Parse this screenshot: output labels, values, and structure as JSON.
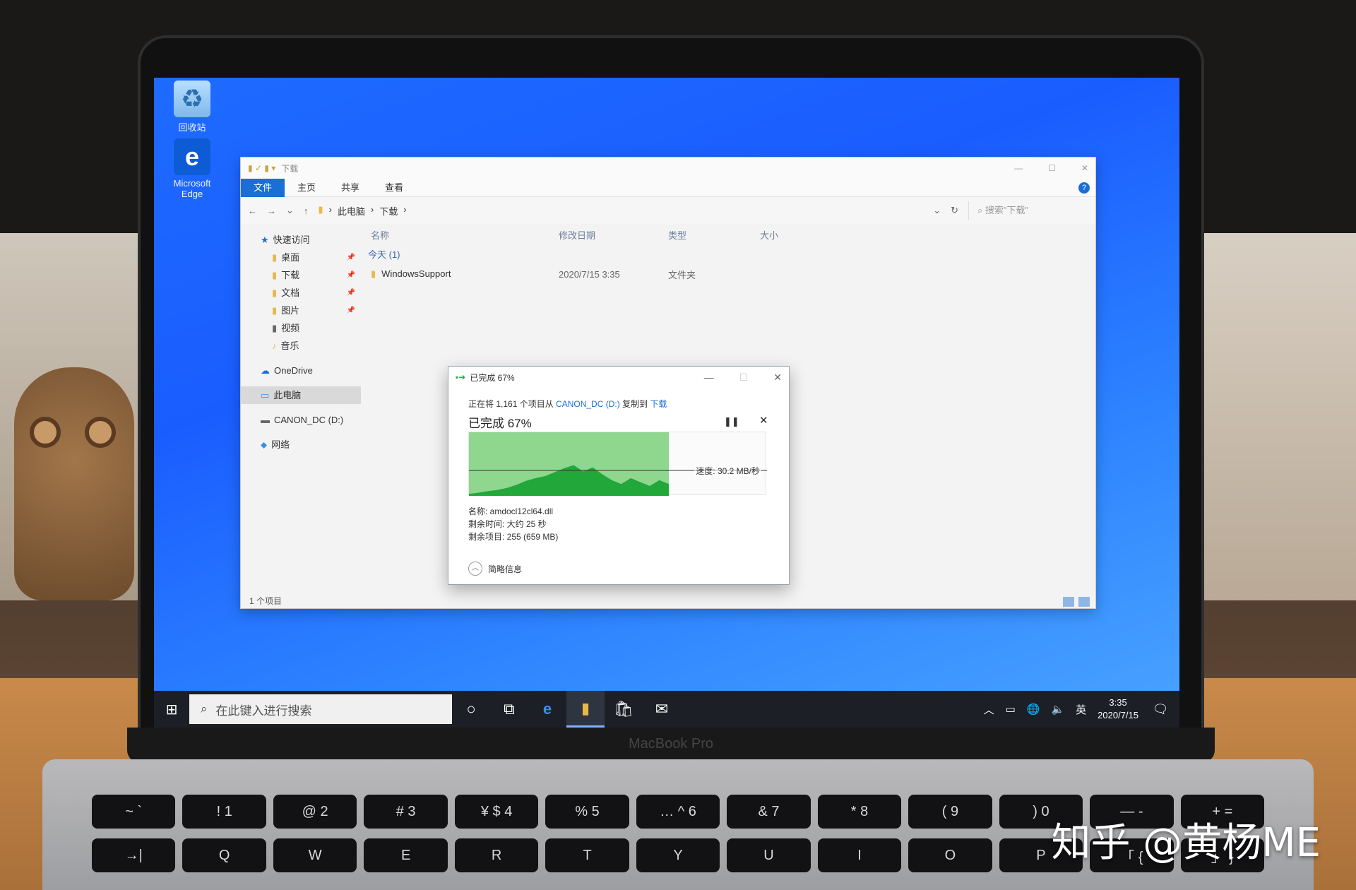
{
  "desktop": {
    "icons": [
      {
        "label": "回收站",
        "icon": "recycle-bin-icon"
      },
      {
        "label": "Microsoft Edge",
        "icon": "edge-icon"
      }
    ]
  },
  "explorer": {
    "title": "下载",
    "ribbon_tabs": [
      "文件",
      "主页",
      "共享",
      "查看"
    ],
    "breadcrumbs": [
      "此电脑",
      "下载"
    ],
    "search_placeholder": "搜索\"下载\"",
    "nav": {
      "quick_access": "快速访问",
      "quick_items": [
        "桌面",
        "下载",
        "文档",
        "图片",
        "视频",
        "音乐"
      ],
      "onedrive": "OneDrive",
      "this_pc": "此电脑",
      "drive": "CANON_DC (D:)",
      "network": "网络"
    },
    "columns": [
      "名称",
      "修改日期",
      "类型",
      "大小"
    ],
    "group": "今天 (1)",
    "rows": [
      {
        "name": "WindowsSupport",
        "date": "2020/7/15 3:35",
        "type": "文件夹",
        "size": ""
      }
    ],
    "status": "1 个项目"
  },
  "dialog": {
    "title": "已完成 67%",
    "line_prefix": "正在将 1,161 个项目从",
    "source": "CANON_DC (D:)",
    "line_mid": "复制到",
    "target": "下载",
    "progress_label": "已完成 67%",
    "progress": 0.67,
    "speed": "速度: 30.2 MB/秒",
    "name": "名称: amdocl12cl64.dll",
    "time_left": "剩余时间: 大约 25 秒",
    "items_left": "剩余项目: 255 (659 MB)",
    "less_details": "简略信息",
    "colors": {
      "fill": "#8fd68f",
      "area": "#22a83a"
    }
  },
  "taskbar": {
    "search_placeholder": "在此键入进行搜索",
    "ime": "英",
    "time": "3:35",
    "date": "2020/7/15"
  },
  "laptop": {
    "model": "MacBook Pro"
  },
  "keyboard": {
    "row1": [
      "~ `",
      "! 1",
      "@ 2",
      "# 3",
      "¥ $ 4",
      "% 5",
      "… ^ 6",
      "& 7",
      "* 8",
      "( 9",
      ") 0",
      "— -",
      "+ ="
    ],
    "row2": [
      "→|",
      "Q",
      "W",
      "E",
      "R",
      "T",
      "Y",
      "U",
      "I",
      "O",
      "P",
      "「 {",
      "」 }"
    ]
  },
  "watermark": "知乎 @黄杨ME"
}
